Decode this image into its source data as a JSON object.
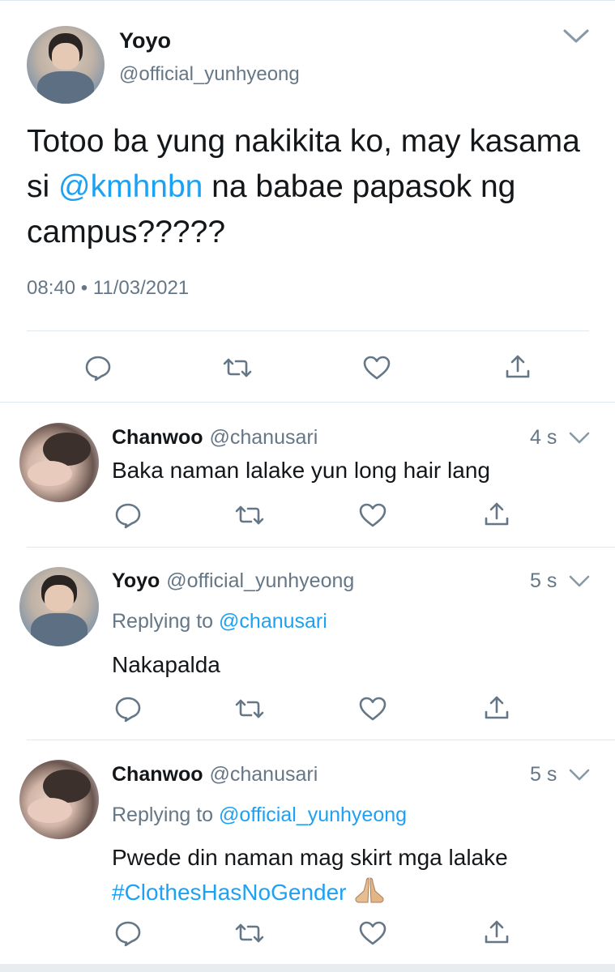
{
  "main_tweet": {
    "name": "Yoyo",
    "handle": "@official_yunhyeong",
    "text_before": "Totoo ba yung nakikita ko, may kasama si ",
    "mention": "@kmhnbn",
    "text_after": " na babae papasok ng campus?????",
    "timestamp": "08:40 • 11/03/2021"
  },
  "replies": [
    {
      "name": "Chanwoo",
      "handle": "@chanusari",
      "time": "4 s",
      "text": "Baka naman lalake yun long hair lang"
    },
    {
      "name": "Yoyo",
      "handle": "@official_yunhyeong",
      "time": "5 s",
      "replying_label": "Replying to",
      "replying_to": "@chanusari",
      "text": "Nakapalda"
    },
    {
      "name": "Chanwoo",
      "handle": "@chanusari",
      "time": "5 s",
      "replying_label": "Replying to",
      "replying_to": "@official_yunhyeong",
      "text": "Pwede din naman mag skirt mga lalake",
      "hashtag": "#ClothesHasNoGender",
      "emoji": "folded-hands"
    }
  ],
  "icons": [
    "chevron-down-icon",
    "reply-icon",
    "retweet-icon",
    "like-icon",
    "share-icon"
  ],
  "colors": {
    "link": "#1da1f2",
    "secondary": "#657786",
    "divider": "#e1e8ed",
    "icon": "#657786"
  }
}
